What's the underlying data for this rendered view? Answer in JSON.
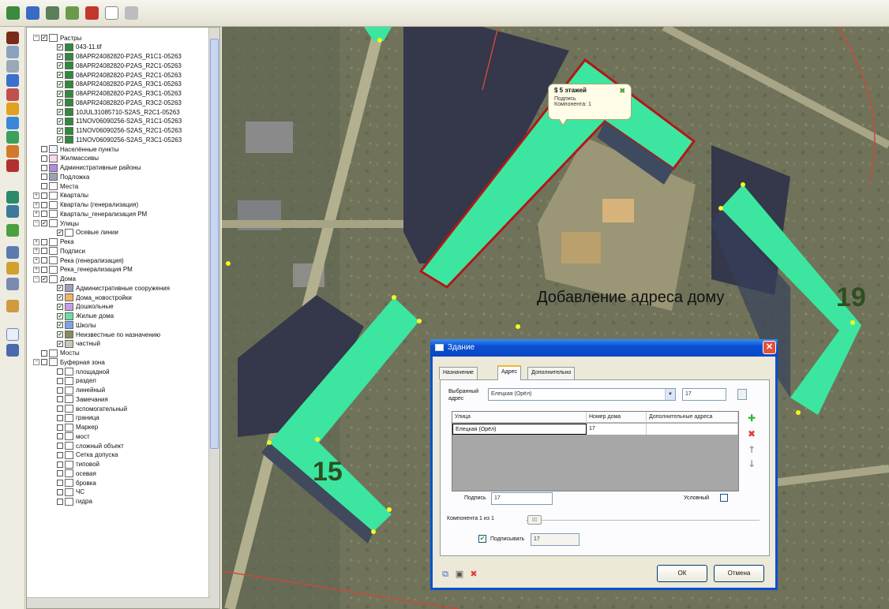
{
  "toolbar": {
    "icons": [
      "layer-icon",
      "save-icon",
      "edit-icon",
      "measure-icon",
      "car-icon",
      "page-icon",
      "print-icon"
    ]
  },
  "left_tools": {
    "icons": [
      "book-icon",
      "search-icon",
      "grid-icon",
      "route-icon",
      "photo-icon",
      "pencil-icon",
      "water-icon",
      "point-icon",
      "chart-icon",
      "factory-icon",
      "globe-icon",
      "shield-icon",
      "leaf-icon",
      "monitor-icon",
      "brush-icon",
      "stack-icon",
      "wand-icon",
      "help-icon",
      "report-icon"
    ]
  },
  "tree": {
    "items": [
      {
        "label": "Растры",
        "exp": "−",
        "checked": true
      },
      {
        "label": "043-11.tif",
        "checked": true
      },
      {
        "label": "08APR24082820-P2AS_R1C1-05263",
        "checked": true
      },
      {
        "label": "08APR24082820-P2AS_R2C1-05263",
        "checked": true
      },
      {
        "label": "08APR24082820-P2AS_R2C1-05263",
        "checked": true
      },
      {
        "label": "08APR24082820-P2AS_R3C1-05263",
        "checked": true
      },
      {
        "label": "08APR24082820-P2AS_R3C1-05263",
        "checked": true
      },
      {
        "label": "08APR24082820-P2AS_R3C2-05263",
        "checked": true
      },
      {
        "label": "10JUL31085710-S2AS_R2C1-05263",
        "checked": true
      },
      {
        "label": "11NOV06090256-S2AS_R1C1-05263",
        "checked": true
      },
      {
        "label": "11NOV06090256-S2AS_R2C1-05263",
        "checked": true
      },
      {
        "label": "11NOV06090256-S2AS_R3C1-05263",
        "checked": true
      },
      {
        "label": "Населённые пункты",
        "checked": false
      },
      {
        "label": "Жилмассивы",
        "checked": false
      },
      {
        "label": "Административные районы",
        "checked": false
      },
      {
        "label": "Подложка",
        "checked": false
      },
      {
        "label": "Места",
        "checked": false
      },
      {
        "label": "Кварталы",
        "exp": "+",
        "checked": false
      },
      {
        "label": "Кварталы (генерализация)",
        "exp": "+",
        "checked": false
      },
      {
        "label": "Кварталы_генерализация РМ",
        "exp": "+",
        "checked": false
      },
      {
        "label": "Улицы",
        "exp": "−",
        "checked": true
      },
      {
        "label": "Осевые линии",
        "checked": true
      },
      {
        "label": "Река",
        "exp": "+",
        "checked": false
      },
      {
        "label": "Подписи",
        "exp": "+",
        "checked": false
      },
      {
        "label": "Река (генерализация)",
        "exp": "+",
        "checked": false
      },
      {
        "label": "Река_генерализация РМ",
        "exp": "+",
        "checked": false
      },
      {
        "label": "Дома",
        "exp": "−",
        "checked": true
      },
      {
        "label": "Административные сооружения",
        "checked": true
      },
      {
        "label": "Дома_новостройки",
        "checked": true
      },
      {
        "label": "Дошкольные",
        "checked": true
      },
      {
        "label": "Жилые дома",
        "checked": true
      },
      {
        "label": "Школы",
        "checked": true
      },
      {
        "label": "Неизвестные по назначению",
        "checked": true
      },
      {
        "label": "частный",
        "checked": true
      },
      {
        "label": "Мосты",
        "checked": false
      },
      {
        "label": "Буферная зона",
        "exp": "−",
        "checked": false
      },
      {
        "label": "площадной",
        "checked": false
      },
      {
        "label": "раздел",
        "checked": false
      },
      {
        "label": "линейный",
        "checked": false
      },
      {
        "label": "Замечания",
        "checked": false
      },
      {
        "label": "вспомогательный",
        "checked": false
      },
      {
        "label": "граница",
        "checked": false
      },
      {
        "label": "Маркер",
        "checked": false
      },
      {
        "label": "мост",
        "checked": false
      },
      {
        "label": "сложный объект",
        "checked": false
      },
      {
        "label": "Сетка допуска",
        "checked": false
      },
      {
        "label": "типовой",
        "checked": false
      },
      {
        "label": "осевая",
        "checked": false
      },
      {
        "label": "бровка",
        "checked": false
      },
      {
        "label": "ЧС",
        "checked": false
      },
      {
        "label": "гидра",
        "checked": false
      }
    ],
    "swatch_colors": {
      "raster": "#2f8a3a",
      "settlements": "#f4f4ff",
      "housing": "#f8d8f0",
      "districts": "#b48ae0",
      "admin": "#9aa3b6",
      "new": "#f2b266",
      "preschool": "#c89ee6",
      "residential": "#66e0a6",
      "schools": "#7fa4e6",
      "unknown": "#8a8a60",
      "private": "#c7c6b8"
    }
  },
  "map": {
    "caption": "Добавление адреса дому",
    "building_numbers": [
      "19",
      "15"
    ],
    "tooltip": {
      "title": "$ 5 этажей",
      "line1": "Подпись",
      "line2": "Компонента: 1"
    },
    "colors": {
      "building_fill": "#3ce6a0",
      "selection_outline": "#b01818",
      "vertex": "#f7f71e",
      "road": "#b3b08f",
      "shadow": "#35374a"
    }
  },
  "dialog": {
    "title": "Здание",
    "tabs": [
      "Назначение",
      "Адрес",
      "Дополнительно"
    ],
    "active_tab": "Адрес",
    "selected_address_label": "Выбранный адрес",
    "selected_street": "Елецкая (Орёл)",
    "house_number_field": "17",
    "table": {
      "headers": [
        "Улица",
        "Номер дома",
        "Дополнительные адреса"
      ],
      "row": [
        "Елецкая (Орёл)",
        "17",
        ""
      ]
    },
    "signature_label": "Подпись",
    "signature_value": "17",
    "conditional_label": "Условный",
    "component_label": "Компонента 1 из 1",
    "sign_checkbox_label": "Подписывать",
    "sign_value": "17",
    "ok_label": "ОК",
    "cancel_label": "Отмена"
  }
}
